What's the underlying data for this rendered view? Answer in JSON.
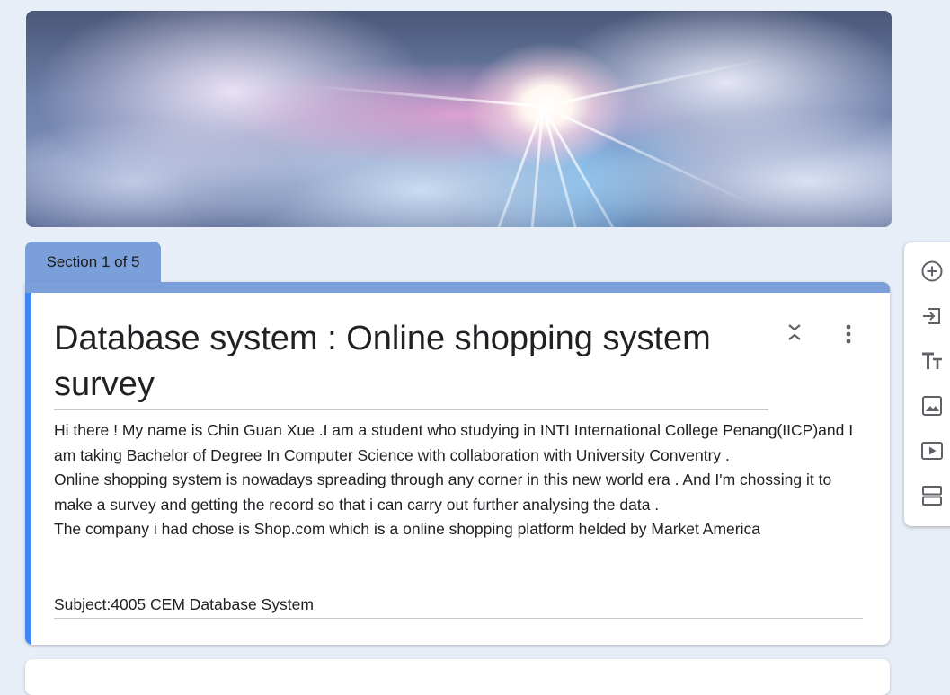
{
  "header": {
    "section_tab_label": "Section 1 of 5"
  },
  "form": {
    "title": "Database system : Online shopping system survey",
    "description": "Hi there ! My name is Chin Guan Xue .I am a student who studying in INTI International College Penang(IICP)and I am taking Bachelor of Degree In Computer Science with collaboration with University Conventry .\nOnline shopping system is nowadays spreading through any corner in this new world era . And I'm chossing it to make a survey and getting the record so that i can carry out further analysing the data .\nThe company i had chose is Shop.com which is a online shopping platform helded by Market America",
    "subject": "Subject:4005 CEM Database System"
  },
  "card_actions": {
    "collapse_icon": "collapse-chevrons-icon",
    "more_icon": "more-vert-icon"
  },
  "toolbar": {
    "items": [
      {
        "icon": "add-circle-icon"
      },
      {
        "icon": "import-icon"
      },
      {
        "icon": "title-text-icon"
      },
      {
        "icon": "image-icon"
      },
      {
        "icon": "video-icon"
      },
      {
        "icon": "section-icon"
      }
    ]
  },
  "colors": {
    "page_bg": "#e8eef8",
    "accent": "#7b9fd9",
    "active_bar": "#4285f4",
    "icon": "#5f6368"
  }
}
